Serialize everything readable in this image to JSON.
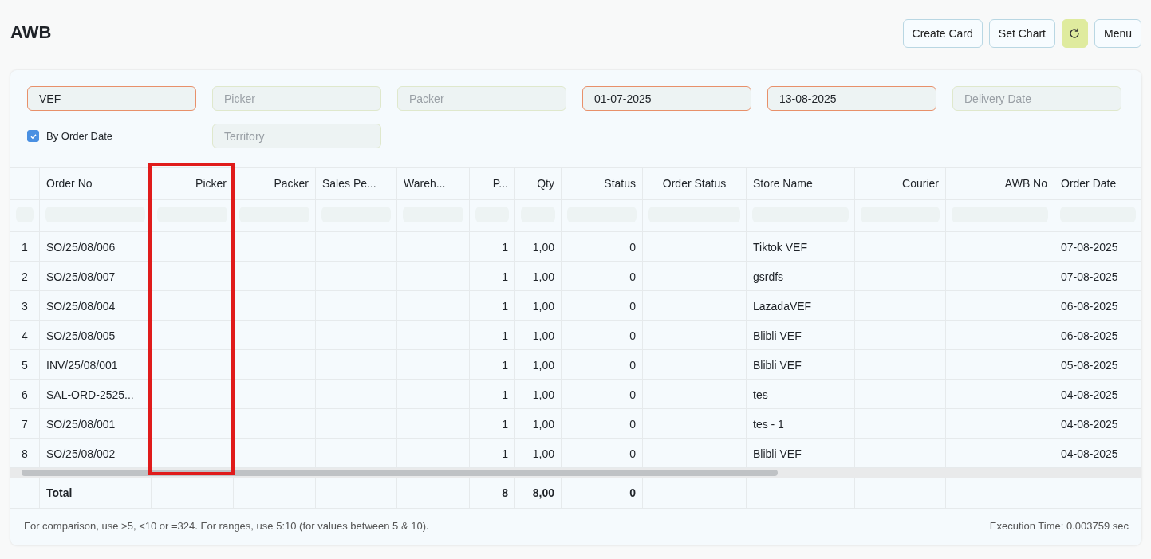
{
  "page": {
    "title": "AWB"
  },
  "actions": [
    {
      "kind": "text",
      "label": "Create Card"
    },
    {
      "kind": "text",
      "label": "Set Chart"
    },
    {
      "kind": "refresh"
    },
    {
      "kind": "text",
      "label": "Menu"
    }
  ],
  "filters": [
    {
      "value": "VEF"
    },
    {
      "placeholder": "Picker"
    },
    {
      "placeholder": "Packer"
    },
    {
      "value": "01-07-2025"
    },
    {
      "value": "13-08-2025"
    },
    {
      "placeholder": "Delivery Date"
    },
    {
      "kind": "checkbox",
      "label": "By Order Date",
      "checked": true
    },
    {
      "placeholder": "Territory"
    }
  ],
  "table": {
    "columns": [
      {
        "label": "Order No",
        "kind": "text",
        "highlighted": false,
        "total": "Total"
      },
      {
        "label": "Picker",
        "kind": "link",
        "highlighted": true
      },
      {
        "label": "Packer",
        "kind": "link",
        "highlighted": false
      },
      {
        "label": "Sales Pe...",
        "kind": "text",
        "highlighted": false
      },
      {
        "label": "Wareh...",
        "kind": "text",
        "highlighted": false
      },
      {
        "label": "P...",
        "kind": "number",
        "highlighted": false,
        "total": "8"
      },
      {
        "label": "Qty",
        "kind": "number",
        "highlighted": false,
        "total": "8,00"
      },
      {
        "label": "Status",
        "kind": "number",
        "highlighted": false,
        "total": "0"
      },
      {
        "label": "Order Status",
        "kind": "center",
        "highlighted": false
      },
      {
        "label": "Store Name",
        "kind": "text",
        "highlighted": false
      },
      {
        "label": "Courier",
        "kind": "link",
        "highlighted": false
      },
      {
        "label": "AWB No",
        "kind": "link",
        "highlighted": false
      },
      {
        "label": "Order Date",
        "kind": "text",
        "highlighted": false
      }
    ],
    "rows": [
      {
        "index": "1",
        "cells": [
          "SO/25/08/006",
          null,
          null,
          null,
          null,
          "1",
          "1,00",
          "0",
          null,
          "Tiktok VEF",
          null,
          null,
          "07-08-2025"
        ]
      },
      {
        "index": "2",
        "cells": [
          "SO/25/08/007",
          null,
          null,
          null,
          null,
          "1",
          "1,00",
          "0",
          null,
          "gsrdfs",
          null,
          null,
          "07-08-2025"
        ]
      },
      {
        "index": "3",
        "cells": [
          "SO/25/08/004",
          null,
          null,
          null,
          null,
          "1",
          "1,00",
          "0",
          null,
          "LazadaVEF",
          null,
          null,
          "06-08-2025"
        ]
      },
      {
        "index": "4",
        "cells": [
          "SO/25/08/005",
          null,
          null,
          null,
          null,
          "1",
          "1,00",
          "0",
          null,
          "Blibli VEF",
          null,
          null,
          "06-08-2025"
        ]
      },
      {
        "index": "5",
        "cells": [
          "INV/25/08/001",
          null,
          null,
          null,
          null,
          "1",
          "1,00",
          "0",
          null,
          "Blibli VEF",
          null,
          null,
          "05-08-2025"
        ]
      },
      {
        "index": "6",
        "cells": [
          "SAL-ORD-2525...",
          null,
          null,
          null,
          null,
          "1",
          "1,00",
          "0",
          null,
          "tes",
          null,
          null,
          "04-08-2025"
        ]
      },
      {
        "index": "7",
        "cells": [
          "SO/25/08/001",
          null,
          null,
          null,
          null,
          "1",
          "1,00",
          "0",
          null,
          "tes - 1",
          null,
          null,
          "04-08-2025"
        ]
      },
      {
        "index": "8",
        "cells": [
          "SO/25/08/002",
          null,
          null,
          null,
          null,
          "1",
          "1,00",
          "0",
          null,
          "Blibli VEF",
          null,
          null,
          "04-08-2025"
        ]
      }
    ]
  },
  "footer": {
    "hint": "For comparison, use >5, <10 or =324. For ranges, use 5:10 (for values between 5 & 10).",
    "execution_time": "Execution Time: 0.003759 sec"
  }
}
